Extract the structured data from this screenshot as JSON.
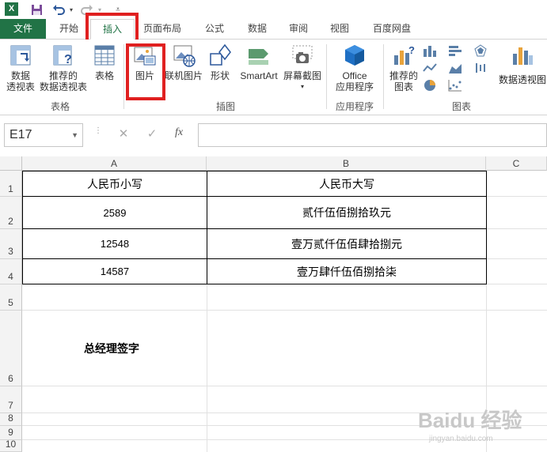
{
  "qat": {
    "logo": "X",
    "icons": [
      "excel-logo-icon",
      "save-icon",
      "undo-icon",
      "redo-icon",
      "customize-qat-icon"
    ]
  },
  "tabs": [
    {
      "label": "文件"
    },
    {
      "label": "开始"
    },
    {
      "label": "插入"
    },
    {
      "label": "页面布局"
    },
    {
      "label": "公式"
    },
    {
      "label": "数据"
    },
    {
      "label": "审阅"
    },
    {
      "label": "视图"
    },
    {
      "label": "百度网盘"
    }
  ],
  "ribbon": {
    "pivot_table_l1": "数据",
    "pivot_table_l2": "透视表",
    "rec_pivot_l1": "推荐的",
    "rec_pivot_l2": "数据透视表",
    "table": "表格",
    "group_tables": "表格",
    "picture": "图片",
    "online_pictures": "联机图片",
    "shapes": "形状",
    "smartart": "SmartArt",
    "screenshot": "屏幕截图",
    "group_illustrations": "插图",
    "office_l1": "Office",
    "office_l2": "应用程序",
    "group_apps": "应用程序",
    "rec_charts_l1": "推荐的",
    "rec_charts_l2": "图表",
    "group_charts": "图表",
    "pivot_chart": "数据透视图"
  },
  "formula_bar": {
    "name_box": "E17",
    "cancel_glyph": "✕",
    "enter_glyph": "✓",
    "fx_label": "fx",
    "formula": ""
  },
  "grid": {
    "columns": [
      "A",
      "B",
      "C"
    ],
    "rows": [
      "1",
      "2",
      "3",
      "4",
      "5",
      "6",
      "7",
      "8",
      "9",
      "10"
    ],
    "cells": {
      "A1": "人民币小写",
      "B1": "人民币大写",
      "A2": "2589",
      "B2": "贰仟伍佰捌拾玖元",
      "A3": "12548",
      "B3": "壹万贰仟伍佰肆拾捌元",
      "A4": "14587",
      "B4": "壹万肆仟伍佰捌拾柒",
      "A6": "总经理签字"
    }
  },
  "watermark": {
    "text": "Baidu 经验",
    "sub": "jingyan.baidu.com"
  },
  "colors": {
    "excel_green": "#217346",
    "highlight_red": "#e02020"
  }
}
